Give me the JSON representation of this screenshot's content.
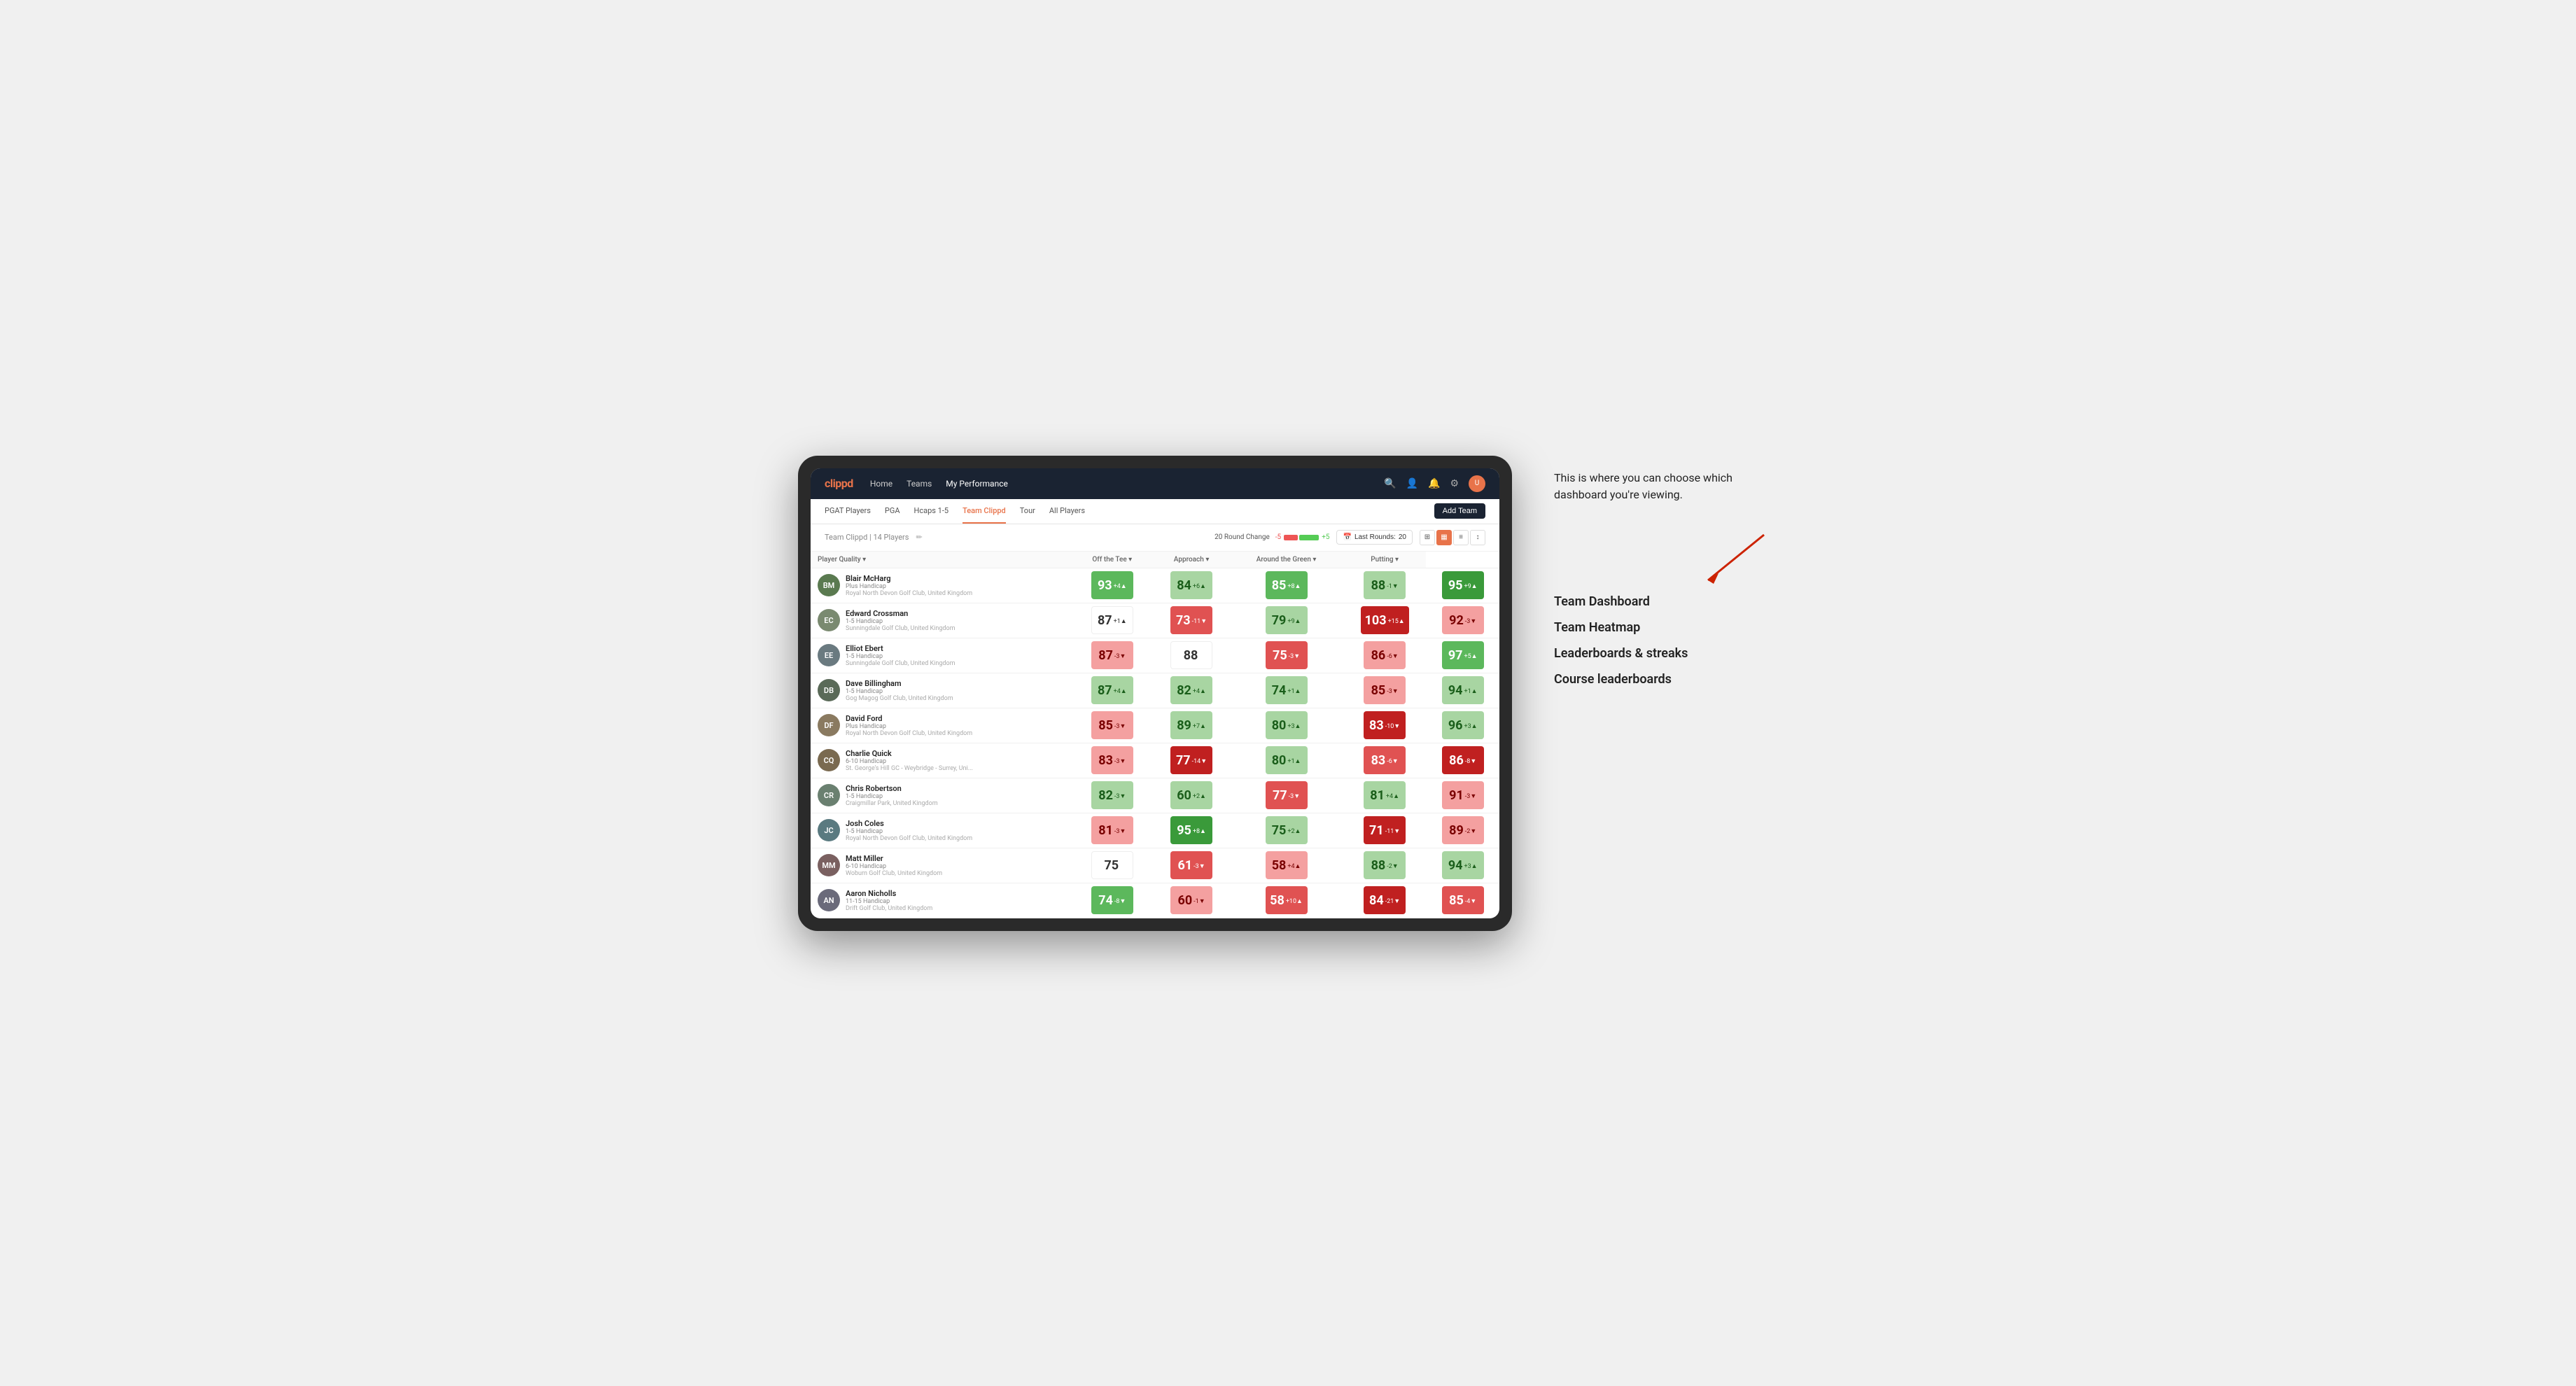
{
  "annotation": {
    "tooltip": "This is where you can choose which dashboard you're viewing.",
    "arrow_label": "→",
    "items": [
      {
        "label": "Team Dashboard"
      },
      {
        "label": "Team Heatmap"
      },
      {
        "label": "Leaderboards & streaks"
      },
      {
        "label": "Course leaderboards"
      }
    ]
  },
  "nav": {
    "logo": "clippd",
    "links": [
      {
        "label": "Home",
        "active": false
      },
      {
        "label": "Teams",
        "active": false
      },
      {
        "label": "My Performance",
        "active": true
      }
    ]
  },
  "sub_nav": {
    "links": [
      {
        "label": "PGAT Players",
        "active": false
      },
      {
        "label": "PGA",
        "active": false
      },
      {
        "label": "Hcaps 1-5",
        "active": false
      },
      {
        "label": "Team Clippd",
        "active": true
      },
      {
        "label": "Tour",
        "active": false
      },
      {
        "label": "All Players",
        "active": false
      }
    ],
    "add_team_label": "Add Team"
  },
  "content_header": {
    "team_name": "Team Clippd",
    "player_count": "14 Players",
    "round_change_label": "20 Round Change",
    "change_neg": "-5",
    "change_pos": "+5",
    "last_rounds_label": "Last Rounds:",
    "last_rounds_value": "20"
  },
  "table": {
    "columns": [
      {
        "label": "Player Quality ▾",
        "key": "quality"
      },
      {
        "label": "Off the Tee ▾",
        "key": "off_tee"
      },
      {
        "label": "Approach ▾",
        "key": "approach"
      },
      {
        "label": "Around the Green ▾",
        "key": "around_green"
      },
      {
        "label": "Putting ▾",
        "key": "putting"
      }
    ],
    "rows": [
      {
        "name": "Blair McHarg",
        "handicap": "Plus Handicap",
        "club": "Royal North Devon Golf Club, United Kingdom",
        "initials": "BM",
        "color": "#7a8a70",
        "quality": {
          "val": 93,
          "change": "+4",
          "dir": "up",
          "bg": "bg-green-mid"
        },
        "off_tee": {
          "val": 84,
          "change": "+6",
          "dir": "up",
          "bg": "bg-green-light"
        },
        "approach": {
          "val": 85,
          "change": "+8",
          "dir": "up",
          "bg": "bg-green-mid"
        },
        "around_green": {
          "val": 88,
          "change": "-1",
          "dir": "down",
          "bg": "bg-green-light"
        },
        "putting": {
          "val": 95,
          "change": "+9",
          "dir": "up",
          "bg": "bg-green-dark"
        }
      },
      {
        "name": "Edward Crossman",
        "handicap": "1-5 Handicap",
        "club": "Sunningdale Golf Club, United Kingdom",
        "initials": "EC",
        "color": "#6a7a80",
        "quality": {
          "val": 87,
          "change": "+1",
          "dir": "up",
          "bg": "bg-white"
        },
        "off_tee": {
          "val": 73,
          "change": "-11",
          "dir": "down",
          "bg": "bg-red-mid"
        },
        "approach": {
          "val": 79,
          "change": "+9",
          "dir": "up",
          "bg": "bg-green-light"
        },
        "around_green": {
          "val": 103,
          "change": "+15",
          "dir": "up",
          "bg": "bg-red-dark"
        },
        "putting": {
          "val": 92,
          "change": "-3",
          "dir": "down",
          "bg": "bg-red-light"
        }
      },
      {
        "name": "Elliot Ebert",
        "handicap": "1-5 Handicap",
        "club": "Sunningdale Golf Club, United Kingdom",
        "initials": "EE",
        "color": "#5a6a58",
        "quality": {
          "val": 87,
          "change": "-3",
          "dir": "down",
          "bg": "bg-red-light"
        },
        "off_tee": {
          "val": 88,
          "change": "",
          "dir": "",
          "bg": "bg-white"
        },
        "approach": {
          "val": 75,
          "change": "-3",
          "dir": "down",
          "bg": "bg-red-mid"
        },
        "around_green": {
          "val": 86,
          "change": "-6",
          "dir": "down",
          "bg": "bg-red-light"
        },
        "putting": {
          "val": 97,
          "change": "+5",
          "dir": "up",
          "bg": "bg-green-mid"
        }
      },
      {
        "name": "Dave Billingham",
        "handicap": "1-5 Handicap",
        "club": "Gog Magog Golf Club, United Kingdom",
        "initials": "DB",
        "color": "#8a7a60",
        "quality": {
          "val": 87,
          "change": "+4",
          "dir": "up",
          "bg": "bg-green-light"
        },
        "off_tee": {
          "val": 82,
          "change": "+4",
          "dir": "up",
          "bg": "bg-green-light"
        },
        "approach": {
          "val": 74,
          "change": "+1",
          "dir": "up",
          "bg": "bg-green-light"
        },
        "around_green": {
          "val": 85,
          "change": "-3",
          "dir": "down",
          "bg": "bg-red-light"
        },
        "putting": {
          "val": 94,
          "change": "+1",
          "dir": "up",
          "bg": "bg-green-light"
        }
      },
      {
        "name": "David Ford",
        "handicap": "Plus Handicap",
        "club": "Royal North Devon Golf Club, United Kingdom",
        "initials": "DF",
        "color": "#7a6a50",
        "quality": {
          "val": 85,
          "change": "-3",
          "dir": "down",
          "bg": "bg-red-light"
        },
        "off_tee": {
          "val": 89,
          "change": "+7",
          "dir": "up",
          "bg": "bg-green-light"
        },
        "approach": {
          "val": 80,
          "change": "+3",
          "dir": "up",
          "bg": "bg-green-light"
        },
        "around_green": {
          "val": 83,
          "change": "-10",
          "dir": "down",
          "bg": "bg-red-dark"
        },
        "putting": {
          "val": 96,
          "change": "+3",
          "dir": "up",
          "bg": "bg-green-light"
        }
      },
      {
        "name": "Charlie Quick",
        "handicap": "6-10 Handicap",
        "club": "St. George's Hill GC - Weybridge - Surrey, Uni...",
        "initials": "CQ",
        "color": "#6a8070",
        "quality": {
          "val": 83,
          "change": "-3",
          "dir": "down",
          "bg": "bg-red-light"
        },
        "off_tee": {
          "val": 77,
          "change": "-14",
          "dir": "down",
          "bg": "bg-red-dark"
        },
        "approach": {
          "val": 80,
          "change": "+1",
          "dir": "up",
          "bg": "bg-green-light"
        },
        "around_green": {
          "val": 83,
          "change": "-6",
          "dir": "down",
          "bg": "bg-red-mid"
        },
        "putting": {
          "val": 86,
          "change": "-8",
          "dir": "down",
          "bg": "bg-red-dark"
        }
      },
      {
        "name": "Chris Robertson",
        "handicap": "1-5 Handicap",
        "club": "Craigmillar Park, United Kingdom",
        "initials": "CR",
        "color": "#5a7a80",
        "quality": {
          "val": 82,
          "change": "-3",
          "dir": "down",
          "bg": "bg-green-light"
        },
        "off_tee": {
          "val": 60,
          "change": "+2",
          "dir": "up",
          "bg": "bg-green-light"
        },
        "approach": {
          "val": 77,
          "change": "-3",
          "dir": "down",
          "bg": "bg-red-mid"
        },
        "around_green": {
          "val": 81,
          "change": "+4",
          "dir": "up",
          "bg": "bg-green-light"
        },
        "putting": {
          "val": 91,
          "change": "-3",
          "dir": "down",
          "bg": "bg-red-light"
        }
      },
      {
        "name": "Josh Coles",
        "handicap": "1-5 Handicap",
        "club": "Royal North Devon Golf Club, United Kingdom",
        "initials": "JC",
        "color": "#7a6060",
        "quality": {
          "val": 81,
          "change": "-3",
          "dir": "down",
          "bg": "bg-red-light"
        },
        "off_tee": {
          "val": 95,
          "change": "+8",
          "dir": "up",
          "bg": "bg-green-dark"
        },
        "approach": {
          "val": 75,
          "change": "+2",
          "dir": "up",
          "bg": "bg-green-light"
        },
        "around_green": {
          "val": 71,
          "change": "-11",
          "dir": "down",
          "bg": "bg-red-dark"
        },
        "putting": {
          "val": 89,
          "change": "-2",
          "dir": "down",
          "bg": "bg-red-light"
        }
      },
      {
        "name": "Matt Miller",
        "handicap": "6-10 Handicap",
        "club": "Woburn Golf Club, United Kingdom",
        "initials": "MM",
        "color": "#6a6a7a",
        "quality": {
          "val": 75,
          "change": "",
          "dir": "",
          "bg": "bg-white"
        },
        "off_tee": {
          "val": 61,
          "change": "-3",
          "dir": "down",
          "bg": "bg-red-mid"
        },
        "approach": {
          "val": 58,
          "change": "+4",
          "dir": "up",
          "bg": "bg-red-light"
        },
        "around_green": {
          "val": 88,
          "change": "-2",
          "dir": "down",
          "bg": "bg-green-light"
        },
        "putting": {
          "val": 94,
          "change": "+3",
          "dir": "up",
          "bg": "bg-green-light"
        }
      },
      {
        "name": "Aaron Nicholls",
        "handicap": "11-15 Handicap",
        "club": "Drift Golf Club, United Kingdom",
        "initials": "AN",
        "color": "#8a7060",
        "quality": {
          "val": 74,
          "change": "-8",
          "dir": "down",
          "bg": "bg-green-mid"
        },
        "off_tee": {
          "val": 60,
          "change": "-1",
          "dir": "down",
          "bg": "bg-red-light"
        },
        "approach": {
          "val": 58,
          "change": "+10",
          "dir": "up",
          "bg": "bg-red-mid"
        },
        "around_green": {
          "val": 84,
          "change": "-21",
          "dir": "down",
          "bg": "bg-red-dark"
        },
        "putting": {
          "val": 85,
          "change": "-4",
          "dir": "down",
          "bg": "bg-red-mid"
        }
      }
    ]
  }
}
